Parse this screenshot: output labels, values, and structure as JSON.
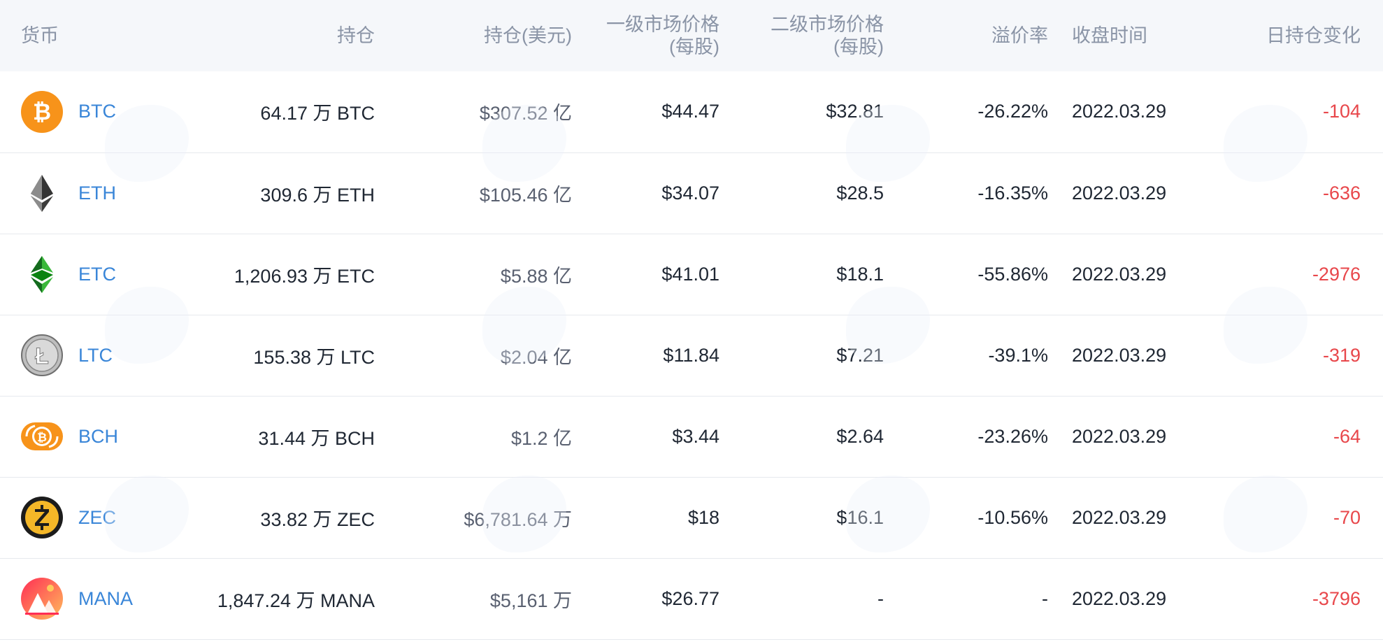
{
  "columns": {
    "currency": "货币",
    "holdings": "持仓",
    "holdings_usd": "持仓(美元)",
    "primary_price_line1": "一级市场价格",
    "primary_price_line2": "(每股)",
    "secondary_price_line1": "二级市场价格",
    "secondary_price_line2": "(每股)",
    "premium": "溢价率",
    "close_time": "收盘时间",
    "daily_change": "日持仓变化"
  },
  "rows": [
    {
      "ticker": "BTC",
      "icon": "bitcoin-icon",
      "holdings": "64.17 万 BTC",
      "holdings_usd": "$307.52 亿",
      "primary_price": "$44.47",
      "secondary_price": "$32.81",
      "premium": "-26.22%",
      "close_time": "2022.03.29",
      "daily_change": "-104"
    },
    {
      "ticker": "ETH",
      "icon": "ethereum-icon",
      "holdings": "309.6 万 ETH",
      "holdings_usd": "$105.46 亿",
      "primary_price": "$34.07",
      "secondary_price": "$28.5",
      "premium": "-16.35%",
      "close_time": "2022.03.29",
      "daily_change": "-636"
    },
    {
      "ticker": "ETC",
      "icon": "ethereum-classic-icon",
      "holdings": "1,206.93 万 ETC",
      "holdings_usd": "$5.88 亿",
      "primary_price": "$41.01",
      "secondary_price": "$18.1",
      "premium": "-55.86%",
      "close_time": "2022.03.29",
      "daily_change": "-2976"
    },
    {
      "ticker": "LTC",
      "icon": "litecoin-icon",
      "holdings": "155.38 万 LTC",
      "holdings_usd": "$2.04 亿",
      "primary_price": "$11.84",
      "secondary_price": "$7.21",
      "premium": "-39.1%",
      "close_time": "2022.03.29",
      "daily_change": "-319"
    },
    {
      "ticker": "BCH",
      "icon": "bitcoin-cash-icon",
      "holdings": "31.44 万 BCH",
      "holdings_usd": "$1.2 亿",
      "primary_price": "$3.44",
      "secondary_price": "$2.64",
      "premium": "-23.26%",
      "close_time": "2022.03.29",
      "daily_change": "-64"
    },
    {
      "ticker": "ZEC",
      "icon": "zcash-icon",
      "holdings": "33.82 万 ZEC",
      "holdings_usd": "$6,781.64 万",
      "primary_price": "$18",
      "secondary_price": "$16.1",
      "premium": "-10.56%",
      "close_time": "2022.03.29",
      "daily_change": "-70"
    },
    {
      "ticker": "MANA",
      "icon": "decentraland-icon",
      "holdings": "1,847.24 万 MANA",
      "holdings_usd": "$5,161 万",
      "primary_price": "$26.77",
      "secondary_price": "-",
      "premium": "-",
      "close_time": "2022.03.29",
      "daily_change": "-3796"
    }
  ],
  "colors": {
    "header_bg": "#f5f7fa",
    "header_text": "#8a94a6",
    "ticker_link": "#3a86d8",
    "negative": "#e8474b",
    "row_border": "#e6e9ee"
  }
}
